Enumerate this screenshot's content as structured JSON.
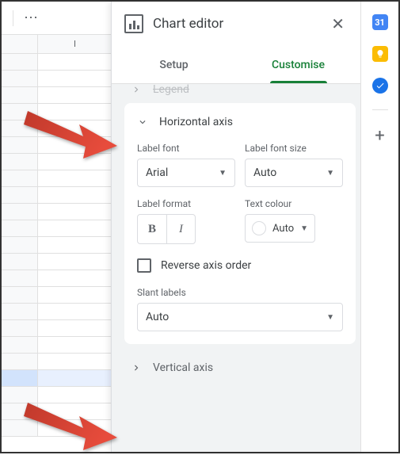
{
  "sheet": {
    "col_header": "I"
  },
  "editor": {
    "title": "Chart editor",
    "tabs": {
      "setup": "Setup",
      "customise": "Customise"
    },
    "sections": {
      "legend": "Legend",
      "horizontal": {
        "title": "Horizontal axis",
        "label_font": {
          "label": "Label font",
          "value": "Arial"
        },
        "label_font_size": {
          "label": "Label font size",
          "value": "Auto"
        },
        "label_format": {
          "label": "Label format"
        },
        "text_colour": {
          "label": "Text colour",
          "value": "Auto"
        },
        "reverse": "Reverse axis order",
        "slant": {
          "label": "Slant labels",
          "value": "Auto"
        }
      },
      "vertical": "Vertical axis"
    }
  },
  "side_panel": {
    "calendar_day": "31"
  }
}
